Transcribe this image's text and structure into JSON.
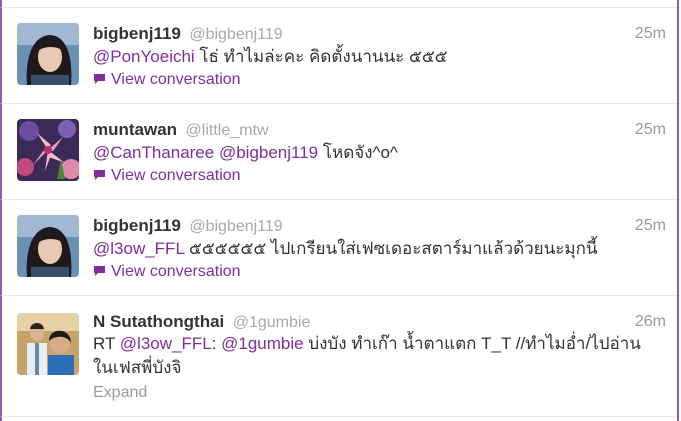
{
  "colors": {
    "accent": "#7f2e9b",
    "border": "#8d5fa7",
    "muted": "#a8a8a8"
  },
  "tweets": [
    {
      "fullname": "bigbenj119",
      "username": "@bigbenj119",
      "time": "25m",
      "avatar": "avatar-girl-icon",
      "mention1": "@PonYoeichi",
      "text1": " โธ่ ทำไมล่ะคะ คิดตั้งนานนะ ๕๕๕",
      "action": "View conversation"
    },
    {
      "fullname": "muntawan",
      "username": "@little_mtw",
      "time": "25m",
      "avatar": "avatar-flowers-icon",
      "mention1": "@CanThanaree",
      "mention2": "@bigbenj119",
      "text2": " โหดจัง^o^",
      "action": "View conversation"
    },
    {
      "fullname": "bigbenj119",
      "username": "@bigbenj119",
      "time": "25m",
      "avatar": "avatar-girl-icon",
      "mention1": "@l3ow_FFL",
      "text1": " ๕๕๕๕๕๕ ไปเกรียนใส่เฟซเดอะสตาร์มาแล้วด้วยนะมุกนี้",
      "action": "View conversation"
    },
    {
      "fullname": "N Sutathongthai",
      "username": "@1gumbie",
      "time": "26m",
      "avatar": "avatar-couple-icon",
      "prefix": "RT ",
      "mention1": "@l3ow_FFL",
      "colon": ": ",
      "mention2": "@1gumbie",
      "text2": " บ่งบัง ทำเก๊า น้ำตาแตก T_T //ทำไมอ่ำ/ไปอ่าน",
      "line2": "ในเฟสพี่บังจิ",
      "action": "Expand"
    }
  ]
}
